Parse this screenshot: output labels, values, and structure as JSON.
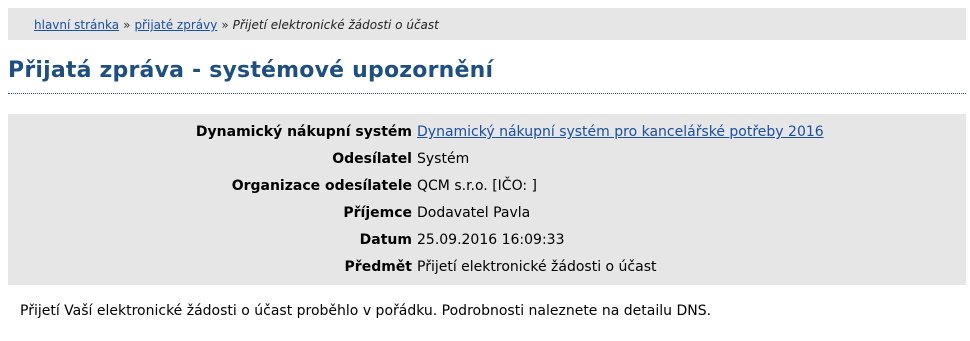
{
  "breadcrumb": {
    "home": "hlavní stránka",
    "separator1": "»",
    "received": "přijaté zprávy",
    "separator2": "»",
    "current": "Přijetí elektronické žádosti o účast"
  },
  "page_title": "Přijatá zpráva - systémové upozornění",
  "details": {
    "dns_label": "Dynamický nákupní systém",
    "dns_value": "Dynamický nákupní systém pro kancelářské potřeby 2016",
    "sender_label": "Odesílatel",
    "sender_value": "Systém",
    "org_label": "Organizace odesílatele",
    "org_value": "QCM s.r.o. [IČO: ]",
    "recipient_label": "Příjemce",
    "recipient_value": "Dodavatel Pavla",
    "date_label": "Datum",
    "date_value": "25.09.2016 16:09:33",
    "subject_label": "Předmět",
    "subject_value": "Přijetí elektronické žádosti o účast"
  },
  "message_body": "Přijetí Vaší elektronické žádosti o účast proběhlo v pořádku. Podrobnosti naleznete na detailu DNS.",
  "colors": {
    "link": "#1a4fa3",
    "title": "#1d4f82",
    "panel_background": "#e6e6e6"
  }
}
